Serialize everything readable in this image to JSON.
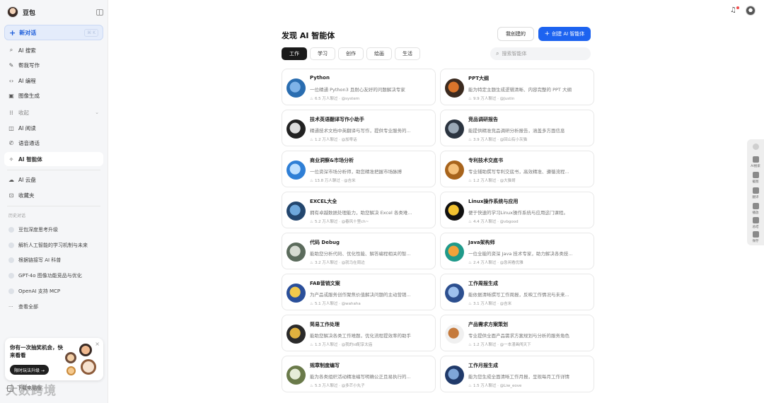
{
  "app": {
    "name": "豆包"
  },
  "sidebar": {
    "new_chat": {
      "label": "新对话",
      "shortcut": "⌘ K"
    },
    "items": [
      {
        "label": "AI 搜索",
        "icon": "search-icon"
      },
      {
        "label": "帮我写作",
        "icon": "pen-icon"
      },
      {
        "label": "AI 编程",
        "icon": "code-icon"
      },
      {
        "label": "图像生成",
        "icon": "image-icon"
      },
      {
        "label": "收起",
        "icon": "grid-icon"
      },
      {
        "label": "AI 阅读",
        "icon": "book-icon"
      },
      {
        "label": "语音通话",
        "icon": "phone-icon"
      },
      {
        "label": "AI 智能体",
        "icon": "sparkle-icon"
      },
      {
        "label": "AI 云盘",
        "icon": "cloud-icon"
      },
      {
        "label": "收藏夹",
        "icon": "bookmark-icon"
      }
    ],
    "history_title": "历史对话",
    "history": [
      "豆包深度思考升级",
      "解析人工智能的学习机制与未来",
      "根据链接写 AI 科普",
      "GPT-4o 图像功能竞品与优化",
      "OpenAI 支持 MCP",
      "查看全部"
    ],
    "promo": {
      "title": "你有一次抽奖机会，快来看看",
      "button": "限时玩法升级 →"
    },
    "download": "下载电脑版",
    "watermark": "大数跨境"
  },
  "main": {
    "title": "发现 AI 智能体",
    "my_agents": "我创建的",
    "create": "创建 AI 智能体",
    "tabs": [
      "工作",
      "学习",
      "创作",
      "绘画",
      "生活"
    ],
    "search_placeholder": "搜索智能体",
    "cards": [
      {
        "name": "Python",
        "desc": "一位精通 Python3 且耐心友好的问题解决专家",
        "meta": "6.5 万人聊过 · @system"
      },
      {
        "name": "PPT大纲",
        "desc": "能为特定主题生成逻辑清晰、内容完整的 PPT 大纲",
        "meta": "9.9 万人聊过 · @Justin"
      },
      {
        "name": "技术英语翻译写作小助手",
        "desc": "精通技术文档中英翻译与写作，提供专业服务的...",
        "meta": "1.2 万人聊过 · @加零话"
      },
      {
        "name": "竞品调研报告",
        "desc": "能提供精准竞品调研分析报告，涵盖多方面信息",
        "meta": "3.9 万人聊过 · @回山有小灰猫"
      },
      {
        "name": "商业洞察&市场分析",
        "desc": "一位资深市场分析师，助您精准把握市场脉搏",
        "meta": "13.8 万人聊过 · @吉米"
      },
      {
        "name": "专利技术交底书",
        "desc": "专业辅助撰写专利交底书，高效精准、遵循流程...",
        "meta": "1.2 万人聊过 · @大猫哥"
      },
      {
        "name": "EXCEL大全",
        "desc": "拥有卓越数据处理能力，助您解决 Excel 各类难...",
        "meta": "5.2 万人聊过 · @春风十里ch~"
      },
      {
        "name": "Linux操作系统与应用",
        "desc": "便于快速的学习Linux操作系统与应用这门课程。",
        "meta": "4.4 万人聊过 · @vbgood"
      },
      {
        "name": "代码 Debug",
        "desc": "能助您分析代码、优化性能、解答编程相关的智...",
        "meta": "3.2 万人聊过 · @就马在周边"
      },
      {
        "name": "Java架构师",
        "desc": "一位全能的资深 Java 技术专家，助力解决各类技...",
        "meta": "2.4 万人聊过 · @急闲看优雅"
      },
      {
        "name": "FAB营销文案",
        "desc": "为产品或服务创作聚焦价值解决问题的主动营销...",
        "meta": "5.1 万人聊过 · @wahaha"
      },
      {
        "name": "工作周报生成",
        "desc": "能依据清晰撰写工作周报，反映工作情况与未来...",
        "meta": "3.1 万人聊过 · @吉米"
      },
      {
        "name": "简易工作处理",
        "desc": "能助您解决各类工作难题，优化流程提效率的助手",
        "meta": "1.3 万人聊过 · @我的id配享太庙"
      },
      {
        "name": "产品需求方案策划",
        "desc": "专业提供全面产品需求方案规划与分析的服务角色",
        "meta": "1.2 万人聊过 · @一本漫画闯天下"
      },
      {
        "name": "规章制度编写",
        "desc": "能为各类组织活动精准编写明确公正且易执行的...",
        "meta": "5.3 万人聊过 · @多芒小丸子"
      },
      {
        "name": "工作月报生成",
        "desc": "能为您生成全面清晰工作月报，呈现每月工作详情",
        "meta": "1.5 万人聊过 · @Liw_eove"
      }
    ]
  },
  "float_bar": [
    "AI搜索",
    "截图",
    "翻译",
    "播放",
    "总结",
    "保存"
  ],
  "colors": {
    "accent": "#1d63f0",
    "active_tab": "#1a1a1a"
  }
}
